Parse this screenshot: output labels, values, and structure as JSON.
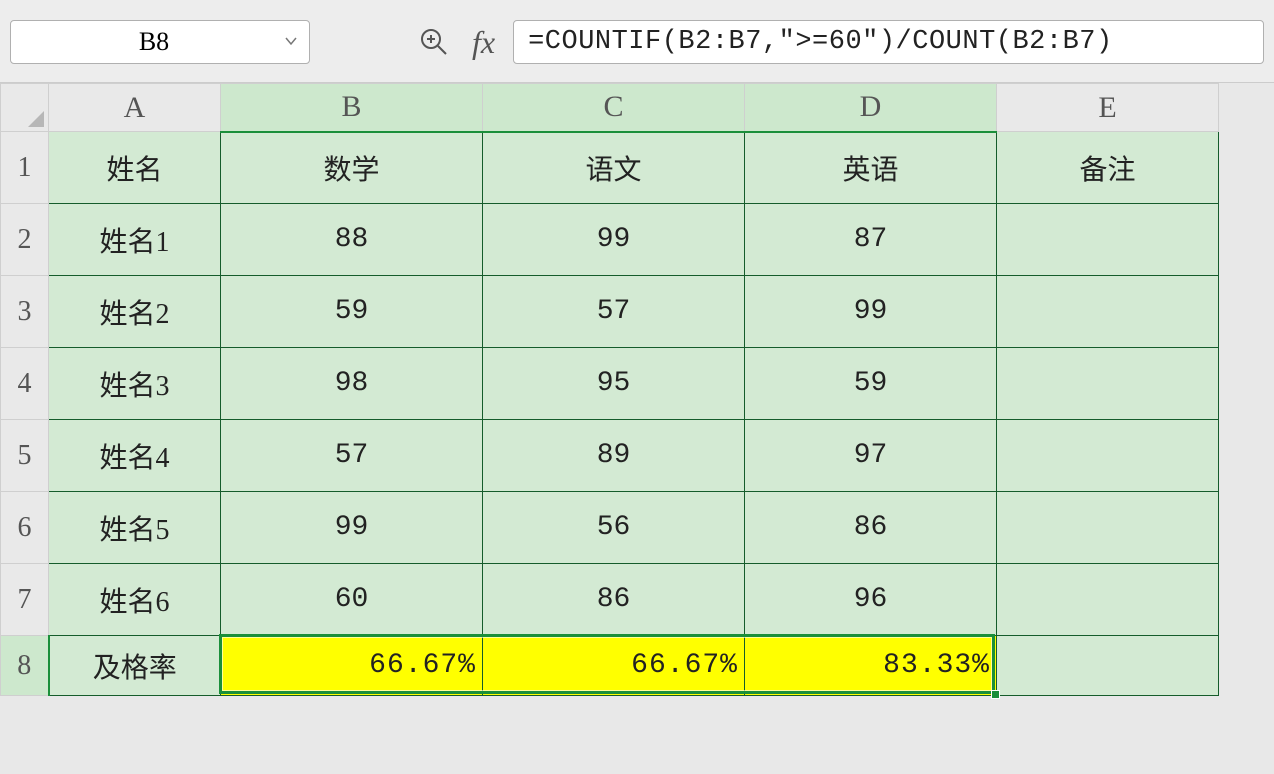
{
  "nameBox": "B8",
  "formula": "=COUNTIF(B2:B7,\">=60\")/COUNT(B2:B7)",
  "columns": [
    "A",
    "B",
    "C",
    "D",
    "E"
  ],
  "rows": [
    "1",
    "2",
    "3",
    "4",
    "5",
    "6",
    "7",
    "8"
  ],
  "header": {
    "A": "姓名",
    "B": "数学",
    "C": "语文",
    "D": "英语",
    "E": "备注"
  },
  "data": [
    {
      "A": "姓名1",
      "B": "88",
      "C": "99",
      "D": "87",
      "E": ""
    },
    {
      "A": "姓名2",
      "B": "59",
      "C": "57",
      "D": "99",
      "E": ""
    },
    {
      "A": "姓名3",
      "B": "98",
      "C": "95",
      "D": "59",
      "E": ""
    },
    {
      "A": "姓名4",
      "B": "57",
      "C": "89",
      "D": "97",
      "E": ""
    },
    {
      "A": "姓名5",
      "B": "99",
      "C": "56",
      "D": "86",
      "E": ""
    },
    {
      "A": "姓名6",
      "B": "60",
      "C": "86",
      "D": "96",
      "E": ""
    }
  ],
  "rateRow": {
    "A": "及格率",
    "B": "66.67%",
    "C": "66.67%",
    "D": "83.33%",
    "E": ""
  },
  "selection": {
    "from": "B8",
    "to": "D8"
  },
  "colWidths": {
    "corner": 48,
    "A": 172,
    "B": 262,
    "C": 262,
    "D": 252,
    "E": 222
  },
  "rowHeights": {
    "hdr": 48,
    "body": 72,
    "rate": 60
  },
  "formulaBarH": 84
}
